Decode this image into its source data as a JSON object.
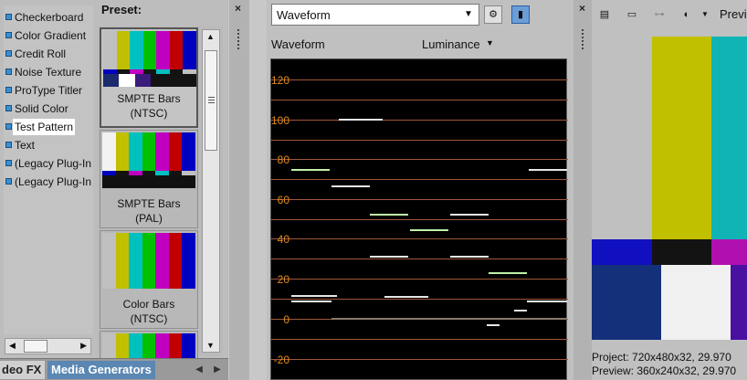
{
  "generators": {
    "items": [
      {
        "label": "Checkerboard"
      },
      {
        "label": "Color Gradient"
      },
      {
        "label": "Credit Roll"
      },
      {
        "label": "Noise Texture"
      },
      {
        "label": "ProType Titler"
      },
      {
        "label": "Solid Color"
      },
      {
        "label": "Test Pattern",
        "selected": true
      },
      {
        "label": "Text"
      },
      {
        "label": "(Legacy Plug-In"
      },
      {
        "label": "(Legacy Plug-In"
      }
    ]
  },
  "presets": {
    "title": "Preset:",
    "items": [
      {
        "line1": "SMPTE Bars",
        "line2": "(NTSC)",
        "selected": true
      },
      {
        "line1": "SMPTE Bars",
        "line2": "(PAL)"
      },
      {
        "line1": "Color Bars",
        "line2": "(NTSC)"
      },
      {
        "line1": "",
        "line2": ""
      }
    ]
  },
  "tabs": {
    "video_fx": "deo FX",
    "media_generators": "Media Generators"
  },
  "scopes": {
    "selected": "Waveform",
    "name": "Waveform",
    "mode": "Luminance",
    "y_ticks": [
      "120",
      "100",
      "80",
      "60",
      "40",
      "20",
      "0",
      "-20"
    ]
  },
  "preview": {
    "label": "Previ",
    "project": "Project:   720x480x32, 29.970",
    "preview_res": "Preview:  360x240x32, 29.970"
  },
  "colors": {
    "tab_active": "#5b87b3",
    "scale_labels": "#e08a1e",
    "gridlines": "#a0583a",
    "trace_white": "#e6e6e6",
    "trace_green": "#bff0a8"
  }
}
